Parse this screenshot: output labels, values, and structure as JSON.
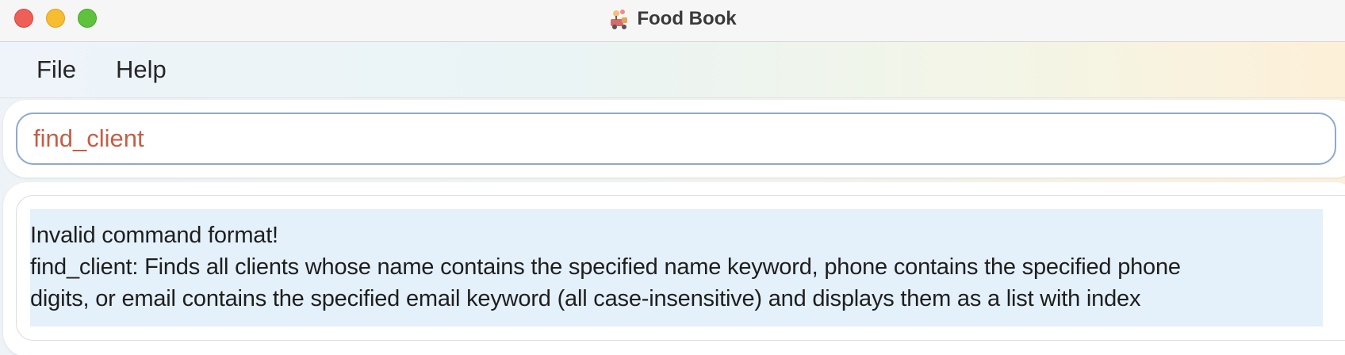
{
  "window": {
    "title": "Food Book",
    "app_icon": "food-book-app-icon"
  },
  "menubar": {
    "file_label": "File",
    "help_label": "Help"
  },
  "command_box": {
    "value": "find_client"
  },
  "result_display": {
    "lines": [
      "Invalid command format!",
      "find_client: Finds all clients whose name contains the specified name keyword, phone contains the specified phone",
      "digits, or email contains the specified email keyword (all case-insensitive) and displays them as a list with index"
    ]
  },
  "colors": {
    "close": "#ee5f57",
    "minimize": "#f5bd2f",
    "zoom": "#5fc23f",
    "command_text": "#c65e45",
    "result_highlight": "#e4f0fa"
  }
}
